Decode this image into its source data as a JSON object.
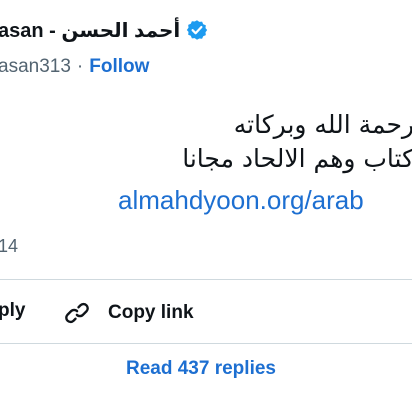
{
  "author": {
    "display_name": "asan - أحمد الحسن",
    "handle_fragment": "asan313",
    "separator": "·",
    "follow_label": "Follow"
  },
  "tweet": {
    "line1": "رحمة الله وبركاته",
    "line2": "كتاب وهم الالحاد مجانا",
    "link_text": "almahdyoon.org/arab",
    "timestamp_fragment": "14"
  },
  "actions": {
    "reply_label": "ply",
    "copy_link_label": "Copy link"
  },
  "replies": {
    "read_label": "Read 437 replies"
  },
  "icons": {
    "verified": "verified-badge-icon",
    "copy_link": "link-icon"
  },
  "colors": {
    "accent": "#1d6fd1",
    "text": "#0f1419",
    "muted": "#536471",
    "divider": "#cfd9de"
  }
}
